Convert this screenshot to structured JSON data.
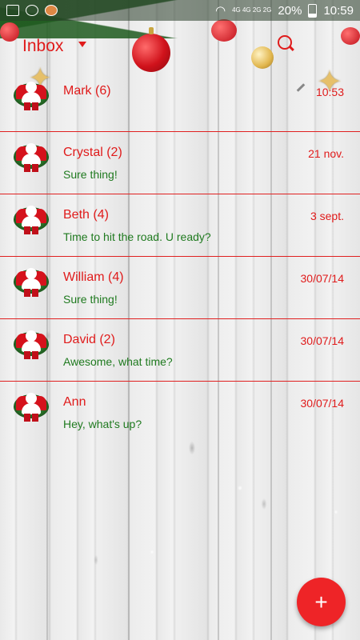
{
  "status_bar": {
    "network": "4G 4G 2G 2G",
    "battery": "20%",
    "time": "10:59"
  },
  "toolbar": {
    "title": "Inbox"
  },
  "conversations": [
    {
      "name": "Mark (6)",
      "date": "10:53",
      "snippet": ""
    },
    {
      "name": "Crystal (2)",
      "date": "21 nov.",
      "snippet": "Sure thing!"
    },
    {
      "name": "Beth (4)",
      "date": "3 sept.",
      "snippet": "Time to hit the road. U ready?"
    },
    {
      "name": "William (4)",
      "date": "30/07/14",
      "snippet": "Sure thing!"
    },
    {
      "name": "David (2)",
      "date": "30/07/14",
      "snippet": "Awesome, what time?"
    },
    {
      "name": "Ann",
      "date": "30/07/14",
      "snippet": "Hey, what's up?"
    }
  ],
  "fab": {
    "label": "+"
  },
  "colors": {
    "accent": "#e01b1b",
    "snippet": "#1f7a1f",
    "fab": "#ee2427"
  }
}
